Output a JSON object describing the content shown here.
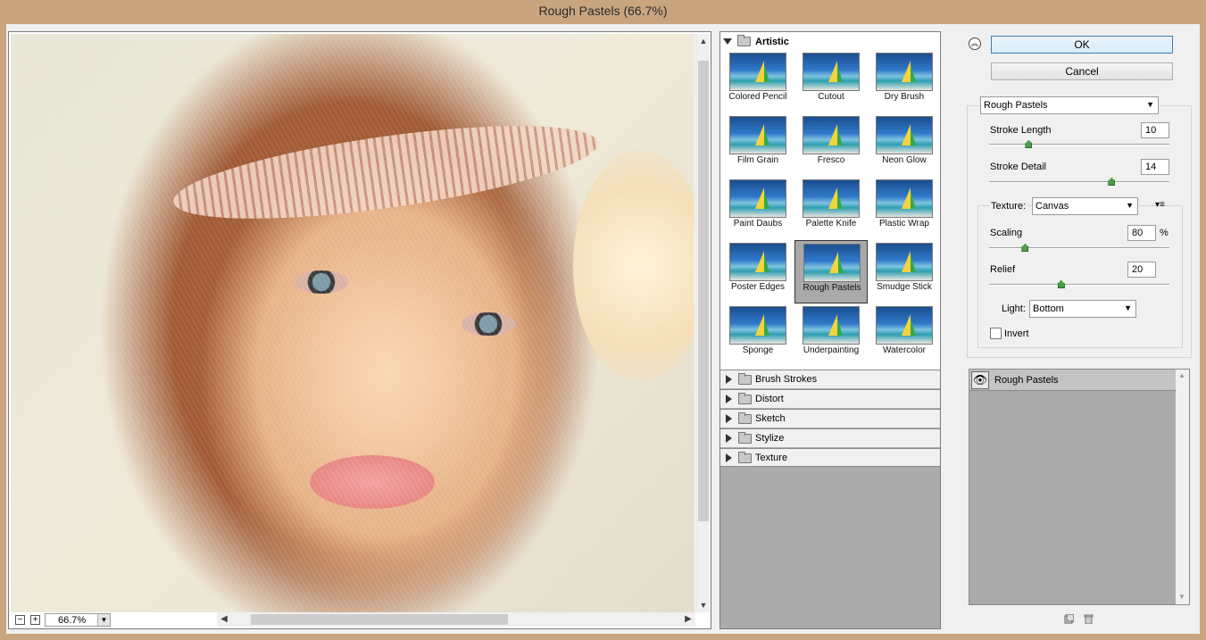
{
  "window": {
    "title": "Rough Pastels (66.7%)"
  },
  "preview": {
    "zoom_value": "66.7%",
    "zoom_out_icon": "minus-icon",
    "zoom_in_icon": "plus-icon"
  },
  "gallery": {
    "open_category": "Artistic",
    "filters": [
      "Colored Pencil",
      "Cutout",
      "Dry Brush",
      "Film Grain",
      "Fresco",
      "Neon Glow",
      "Paint Daubs",
      "Palette Knife",
      "Plastic Wrap",
      "Poster Edges",
      "Rough Pastels",
      "Smudge Stick",
      "Sponge",
      "Underpainting",
      "Watercolor"
    ],
    "selected_filter": "Rough Pastels",
    "categories": [
      "Brush Strokes",
      "Distort",
      "Sketch",
      "Stylize",
      "Texture"
    ]
  },
  "buttons": {
    "ok": "OK",
    "cancel": "Cancel"
  },
  "settings": {
    "filter_select": "Rough Pastels",
    "stroke_length": {
      "label": "Stroke Length",
      "value": "10",
      "fraction": 0.22
    },
    "stroke_detail": {
      "label": "Stroke Detail",
      "value": "14",
      "fraction": 0.68
    },
    "texture": {
      "label": "Texture:",
      "value": "Canvas"
    },
    "scaling": {
      "label": "Scaling",
      "value": "80",
      "unit": "%",
      "fraction": 0.2
    },
    "relief": {
      "label": "Relief",
      "value": "20",
      "fraction": 0.4
    },
    "light": {
      "label": "Light:",
      "value": "Bottom"
    },
    "invert": {
      "label": "Invert",
      "checked": false
    }
  },
  "layers": {
    "items": [
      "Rough Pastels"
    ],
    "new_layer_icon": "new-effect-layer-icon",
    "delete_icon": "trash-icon"
  }
}
